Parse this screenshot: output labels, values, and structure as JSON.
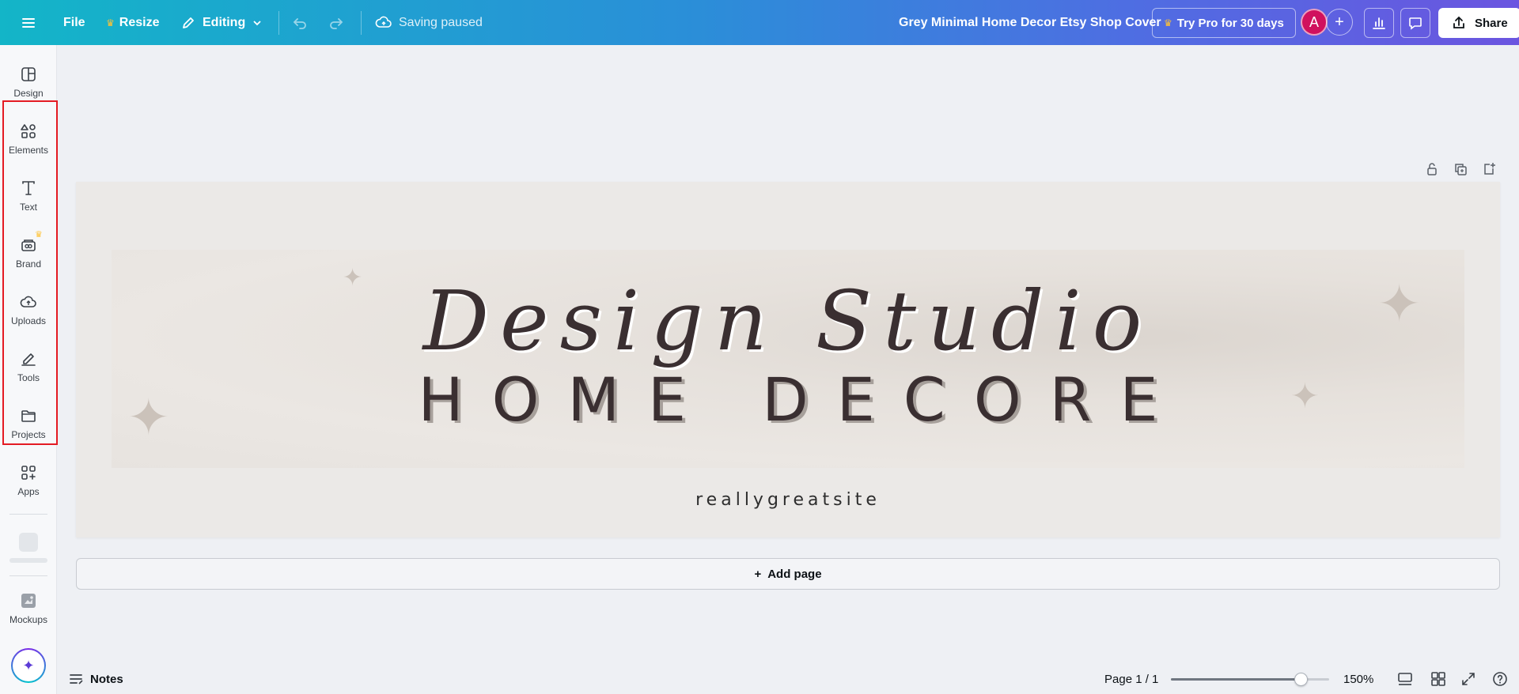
{
  "topbar": {
    "file_label": "File",
    "resize_label": "Resize",
    "editing_label": "Editing",
    "saving_status": "Saving paused",
    "doc_title": "Grey Minimal Home Decor Etsy Shop Cover",
    "trypro_label": "Try Pro for 30 days",
    "avatar_initial": "A",
    "share_label": "Share"
  },
  "sidebar": {
    "items": [
      {
        "label": "Design",
        "icon": "design-icon"
      },
      {
        "label": "Elements",
        "icon": "elements-icon"
      },
      {
        "label": "Text",
        "icon": "text-icon"
      },
      {
        "label": "Brand",
        "icon": "brand-icon"
      },
      {
        "label": "Uploads",
        "icon": "uploads-icon"
      },
      {
        "label": "Tools",
        "icon": "tools-icon"
      },
      {
        "label": "Projects",
        "icon": "projects-icon"
      },
      {
        "label": "Apps",
        "icon": "apps-icon"
      },
      {
        "label": "Mockups",
        "icon": "mockups-icon"
      }
    ]
  },
  "canvas": {
    "title_script": "Design Studio",
    "subtitle": "HOME DECORE",
    "site": "reallygreatsite",
    "add_page_label": "Add page"
  },
  "bottombar": {
    "notes_label": "Notes",
    "page_indicator": "Page 1 / 1",
    "zoom_label": "150%",
    "zoom_fraction": 0.82
  },
  "colors": {
    "accent_gradient_start": "#13b5c8",
    "accent_gradient_end": "#6b55e0",
    "highlight_border": "#e41b23",
    "avatar_bg": "#d0115e",
    "crown": "#ffc233"
  }
}
